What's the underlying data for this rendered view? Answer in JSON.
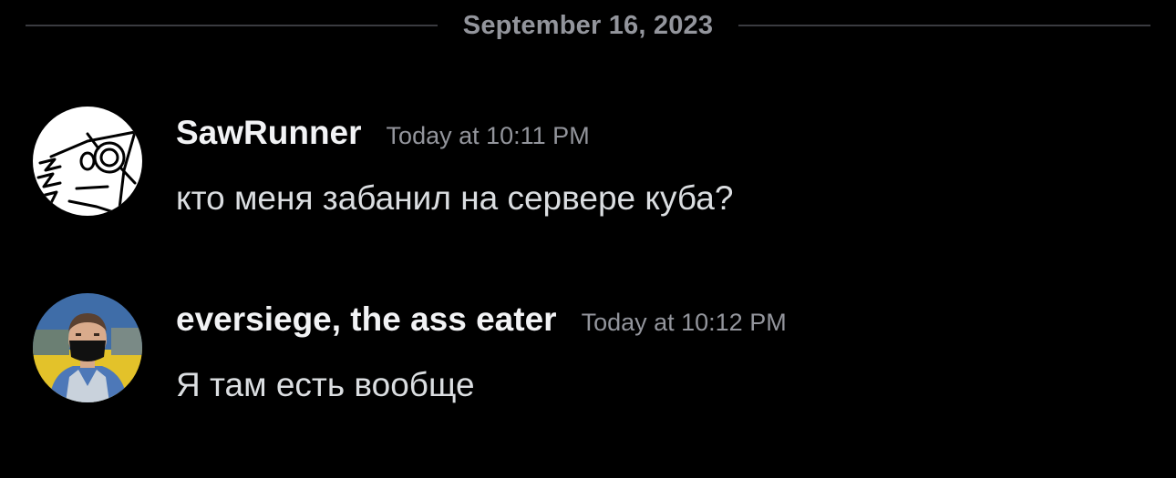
{
  "date_divider": {
    "label": "September 16, 2023"
  },
  "messages": [
    {
      "username": "SawRunner",
      "timestamp": "Today at 10:11 PM",
      "text": "кто меня забанил на сервере куба?",
      "avatar_icon": "sketch-magnifier-face-avatar"
    },
    {
      "username": "eversiege, the ass eater",
      "timestamp": "Today at 10:12 PM",
      "text": "Я там есть вообще",
      "avatar_icon": "photo-avatar"
    }
  ],
  "colors": {
    "background": "#000000",
    "username": "#f2f3f5",
    "timestamp": "#93959c",
    "message_text": "#dbdee1",
    "divider_line": "#3a3b40"
  }
}
